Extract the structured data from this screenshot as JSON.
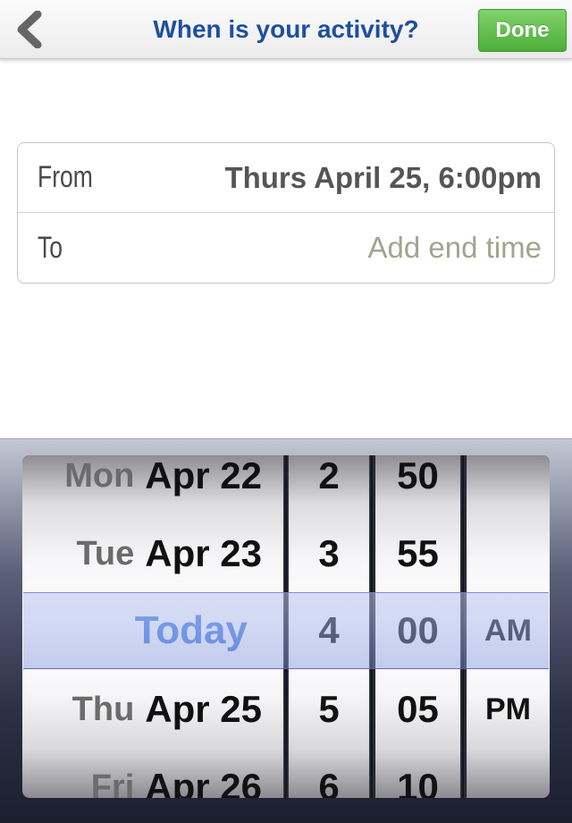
{
  "nav": {
    "title": "When is your activity?",
    "done_label": "Done",
    "back_icon": "chevron-left-icon"
  },
  "form": {
    "from_label": "From",
    "from_value": "Thurs April 25, 6:00pm",
    "to_label": "To",
    "to_placeholder": "Add end time"
  },
  "picker": {
    "days": [
      {
        "weekday": "Mon",
        "date": "Apr 22"
      },
      {
        "weekday": "Tue",
        "date": "Apr 23"
      },
      {
        "label": "Today"
      },
      {
        "weekday": "Thu",
        "date": "Apr 25"
      },
      {
        "weekday": "Fri",
        "date": "Apr 26"
      }
    ],
    "hours": [
      "2",
      "3",
      "4",
      "5",
      "6"
    ],
    "minutes": [
      "50",
      "55",
      "00",
      "05",
      "10"
    ],
    "ampm": [
      "AM",
      "PM"
    ]
  },
  "colors": {
    "title": "#1d4fa1",
    "done_button": "#5cb944",
    "today": "#4a7fe0",
    "placeholder": "#a2a48e"
  }
}
